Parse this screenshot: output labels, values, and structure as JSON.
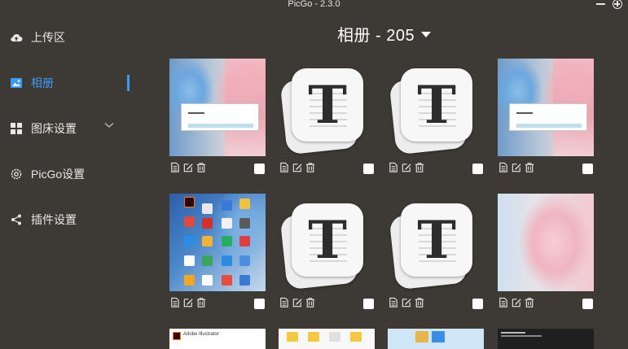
{
  "window": {
    "title": "PicGo - 2.3.0"
  },
  "sidebar": {
    "items": [
      {
        "label": "上传区",
        "icon": "cloud-upload-icon"
      },
      {
        "label": "相册",
        "icon": "image-icon",
        "active": true
      },
      {
        "label": "图床设置",
        "icon": "grid-icon",
        "has_submenu": true
      },
      {
        "label": "PicGo设置",
        "icon": "gear-icon"
      },
      {
        "label": "插件设置",
        "icon": "share-icon"
      }
    ]
  },
  "gallery": {
    "title": "相册 - 205",
    "action_icons": [
      "copy-icon",
      "edit-icon",
      "delete-icon"
    ],
    "rows": [
      [
        "anime-screenshot",
        "typora-t",
        "typora-t",
        "anime-screenshot"
      ],
      [
        "desktop-screenshot",
        "typora-t",
        "typora-t",
        "pink-hair-girl"
      ],
      [
        "adobe-illustrator",
        "file-explorer",
        "folder-window",
        "terminal-window"
      ]
    ],
    "partial_text": {
      "adobe": "Adobe Illustrator"
    }
  },
  "colors": {
    "background": "#3d3a36",
    "accent": "#3c9cf3",
    "text": "#e8e8e8"
  }
}
